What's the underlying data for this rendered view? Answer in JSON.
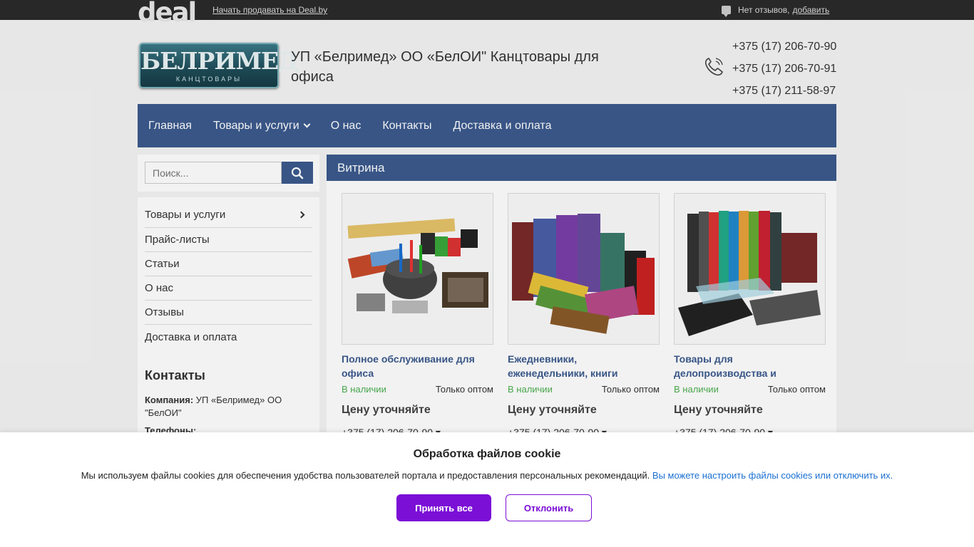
{
  "topbar": {
    "logo": "deal",
    "sell_link": "Начать продавать на Deal.by",
    "reviews_text": "Нет отзывов,",
    "reviews_add": "добавить"
  },
  "header": {
    "logo_title": "БЕЛРИМЕД",
    "logo_subtitle": "КАНЦТОВАРЫ",
    "company_name": "УП «Белримед» ОО «БелОИ\" Канцтовары для офиса",
    "phones": [
      "+375 (17) 206-70-90",
      "+375 (17) 206-70-91",
      "+375 (17) 211-58-97"
    ]
  },
  "nav": {
    "items": [
      "Главная",
      "Товары и услуги",
      "О нас",
      "Контакты",
      "Доставка и оплата"
    ]
  },
  "search": {
    "placeholder": "Поиск..."
  },
  "sidebar": {
    "items": [
      "Товары и услуги",
      "Прайс-листы",
      "Статьи",
      "О нас",
      "Отзывы",
      "Доставка и оплата"
    ],
    "contacts_title": "Контакты",
    "company_label": "Компания:",
    "company_value": "УП «Белримед» ОО \"БелОИ\"",
    "phones_label": "Телефоны:"
  },
  "main": {
    "header": "Витрина",
    "cards": [
      {
        "title": "Полное обслуживание для офиса",
        "stock": "В наличии",
        "wholesale": "Только оптом",
        "price": "Цену уточняйте",
        "phone": "+375 (17) 206-70-90 ▾"
      },
      {
        "title": "Ежедневники, еженедельники, книги",
        "stock": "В наличии",
        "wholesale": "Только оптом",
        "price": "Цену уточняйте",
        "phone": "+375 (17) 206-70-90 ▾"
      },
      {
        "title": "Товары для делопроизводства и",
        "stock": "В наличии",
        "wholesale": "Только оптом",
        "price": "Цену уточняйте",
        "phone": "+375 (17) 206-70-90 ▾"
      }
    ]
  },
  "cookie": {
    "title": "Обработка файлов cookie",
    "text": "Мы используем файлы cookies для обеспечения удобства пользователей портала и предоставления персональных рекомендаций.",
    "link": "Вы можете настроить файлы cookies или отключить их.",
    "accept": "Принять все",
    "decline": "Отклонить"
  }
}
